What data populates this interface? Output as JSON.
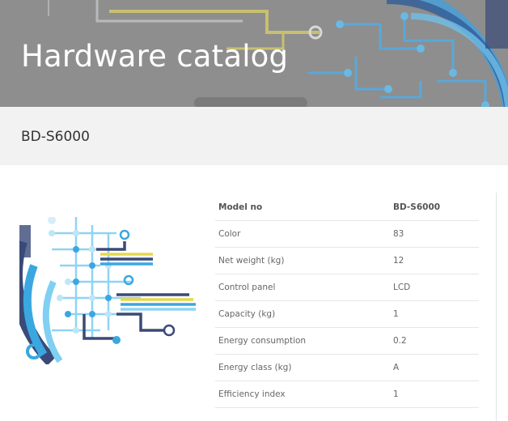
{
  "header": {
    "title": "Hardware catalog"
  },
  "product": {
    "name": "BD-S6000"
  },
  "specs": {
    "header": {
      "label": "Model no",
      "value": "BD-S6000"
    },
    "rows": [
      {
        "label": "Color",
        "value": "83"
      },
      {
        "label": "Net weight (kg)",
        "value": "12"
      },
      {
        "label": "Control panel",
        "value": "LCD"
      },
      {
        "label": "Capacity (kg)",
        "value": "1"
      },
      {
        "label": "Energy consumption",
        "value": "0.2"
      },
      {
        "label": "Energy class (kg)",
        "value": "A"
      },
      {
        "label": "Efficiency index",
        "value": "1"
      }
    ]
  },
  "colors": {
    "hero_overlay": "#8a8a8a",
    "subbar_bg": "#f2f2f2",
    "circuit_blue": "#3aa7e0",
    "circuit_light": "#7fd0f2",
    "circuit_navy": "#3a4a78",
    "circuit_yellow": "#e8d84a"
  },
  "icons": {
    "product_image": "circuit-board-illustration",
    "hero_background": "circuit-board-banner"
  }
}
